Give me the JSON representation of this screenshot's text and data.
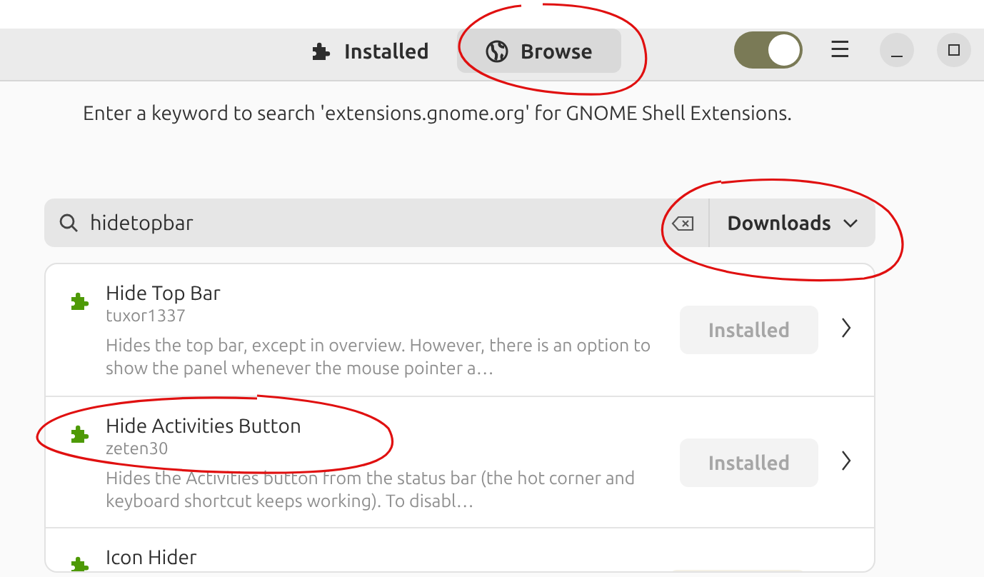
{
  "header": {
    "tabs": [
      {
        "label": "Installed",
        "selected": false
      },
      {
        "label": "Browse",
        "selected": true
      }
    ],
    "toggle": {
      "on": true
    },
    "menu_icon": "☰"
  },
  "hint": "Enter a keyword to search 'extensions.gnome.org' for GNOME Shell Extensions.",
  "search": {
    "value": "hidetopbar",
    "sort": "Downloads"
  },
  "results": [
    {
      "name": "Hide Top Bar",
      "author": "tuxor1337",
      "description": "Hides the top bar, except in overview. However, there is an option to show the panel whenever the mouse pointer a…",
      "action": "Installed",
      "disabled": true
    },
    {
      "name": "Hide Activities Button",
      "author": "zeten30",
      "description": "Hides the Activities button from the status bar (the hot corner and keyboard shortcut keeps working). To disabl…",
      "action": "Installed",
      "disabled": true
    },
    {
      "name": "Icon Hider"
    }
  ]
}
